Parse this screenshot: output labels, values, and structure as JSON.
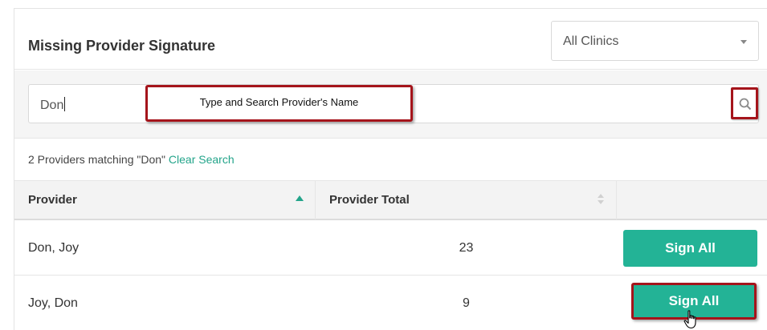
{
  "header": {
    "title": "Missing Provider Signature",
    "clinic_filter": {
      "selected": "All Clinics"
    }
  },
  "search": {
    "value": "Don",
    "callout_text": "Type and Search Provider's Name"
  },
  "results": {
    "summary": "2 Providers matching \"Don\"",
    "clear_label": "Clear Search"
  },
  "table": {
    "columns": [
      "Provider",
      "Provider Total",
      ""
    ],
    "sort": {
      "column": "Provider",
      "direction": "ascending"
    },
    "rows": [
      {
        "provider": "Don, Joy",
        "total": "23",
        "action": "Sign All"
      },
      {
        "provider": "Joy, Don",
        "total": "9",
        "action": "Sign All"
      }
    ]
  },
  "colors": {
    "accent": "#23b396",
    "link": "#23a48a",
    "annotation_border": "#a5141b"
  },
  "icons": {
    "search": "magnifier-icon",
    "dropdown": "chevron-down-icon",
    "cursor": "hand-pointer-icon"
  }
}
